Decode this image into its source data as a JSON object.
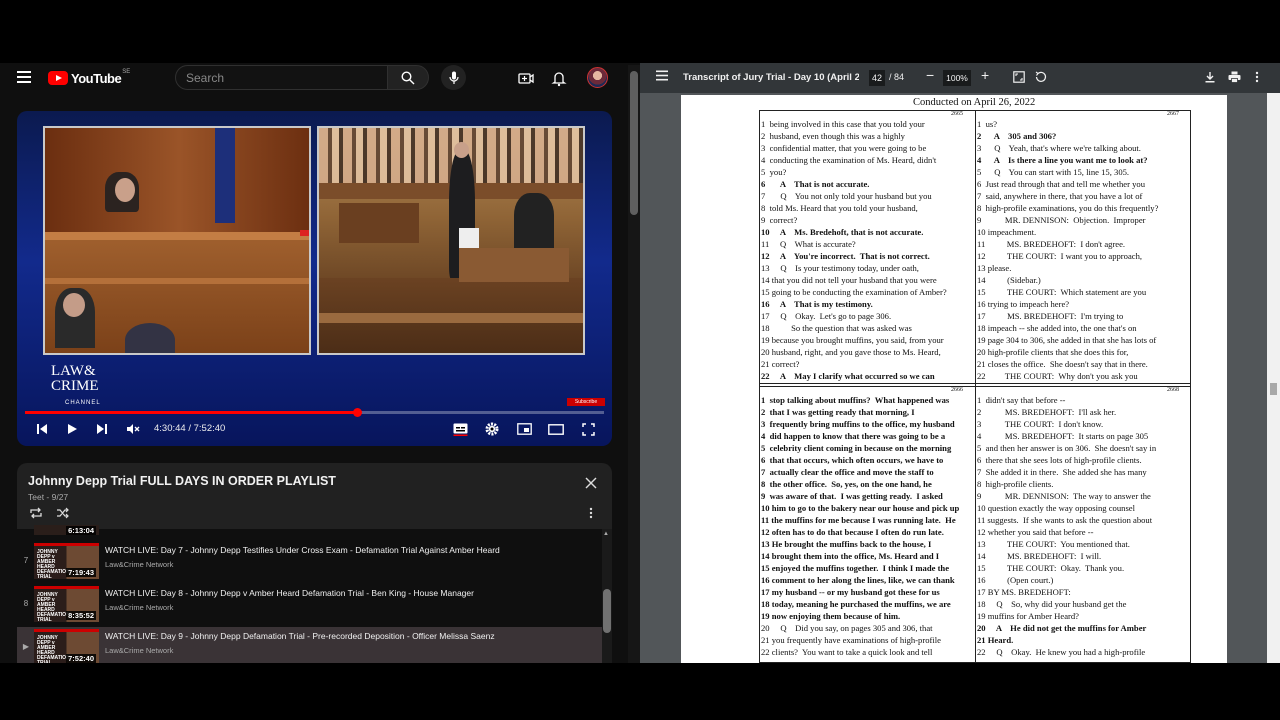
{
  "youtube": {
    "logo_text": "YouTube",
    "country_code": "SE",
    "search_placeholder": "Search",
    "player": {
      "channel_logo_line1": "LAW&",
      "channel_logo_line2": "CRIME",
      "channel_logo_line3": "CHANNEL",
      "subscribe_badge": "Subscribe",
      "time_current": "4:30:44",
      "time_total": "7:52:40",
      "progress_fraction": 0.573
    },
    "playlist": {
      "title": "Johnny Depp Trial FULL DAYS IN ORDER PLAYLIST",
      "subtitle": "Teet - 9/27",
      "top_partial_duration": "6:13:04",
      "items": [
        {
          "index": "7",
          "title": "WATCH LIVE: Day 7 - Johnny Depp Testifies Under Cross Exam - Defamation Trial Against Amber Heard",
          "channel": "Law&Crime Network",
          "duration": "7:19:43",
          "thumb_text": "JOHNNY DEPP v AMBER HEARD DEFAMATION TRIAL"
        },
        {
          "index": "8",
          "title": "WATCH LIVE: Day 8 - Johnny Depp v Amber Heard Defamation Trial - Ben King - House Manager",
          "channel": "Law&Crime Network",
          "duration": "8:35:52",
          "thumb_text": "JOHNNY DEPP v AMBER HEARD DEFAMATION TRIAL"
        },
        {
          "index": "▶",
          "title": "WATCH LIVE: Day 9 - Johnny Depp Defamation Trial - Pre-recorded Deposition - Officer Melissa Saenz",
          "channel": "Law&Crime Network",
          "duration": "7:52:40",
          "thumb_text": "JOHNNY DEPP v AMBER HEARD DEFAMATION TRIAL"
        }
      ]
    }
  },
  "pdf": {
    "title": "Transcript of Jury Trial - Day 10 (April 2...",
    "page_current": "42",
    "page_total": "/ 84",
    "zoom": "100%",
    "header": "Conducted on April 26, 2022",
    "quadrants": [
      {
        "page_no": "2665",
        "lines": [
          {
            "t": "1  being involved in this case that you told your",
            "b": false
          },
          {
            "t": "2  husband, even though this was a highly",
            "b": false
          },
          {
            "t": "3  confidential matter, that you were going to be",
            "b": false
          },
          {
            "t": "4  conducting the examination of Ms. Heard, didn't",
            "b": false
          },
          {
            "t": "5  you?",
            "b": false
          },
          {
            "t": "6       A    That is not accurate.",
            "b": true
          },
          {
            "t": "7       Q    You not only told your husband but you",
            "b": false
          },
          {
            "t": "8  told Ms. Heard that you told your husband,",
            "b": false
          },
          {
            "t": "9  correct?",
            "b": false
          },
          {
            "t": "10     A    Ms. Bredehoft, that is not accurate.",
            "b": true
          },
          {
            "t": "11     Q    What is accurate?",
            "b": false
          },
          {
            "t": "12     A    You're incorrect.  That is not correct.",
            "b": true
          },
          {
            "t": "13     Q    Is your testimony today, under oath,",
            "b": false
          },
          {
            "t": "14 that you did not tell your husband that you were",
            "b": false
          },
          {
            "t": "15 going to be conducting the examination of Amber?",
            "b": false
          },
          {
            "t": "16     A    That is my testimony.",
            "b": true
          },
          {
            "t": "17     Q    Okay.  Let's go to page 306.",
            "b": false
          },
          {
            "t": "18          So the question that was asked was",
            "b": false
          },
          {
            "t": "19 because you brought muffins, you said, from your",
            "b": false
          },
          {
            "t": "20 husband, right, and you gave those to Ms. Heard,",
            "b": false
          },
          {
            "t": "21 correct?",
            "b": false
          },
          {
            "t": "22     A    May I clarify what occurred so we can",
            "b": true
          }
        ]
      },
      {
        "page_no": "2667",
        "lines": [
          {
            "t": "1  us?",
            "b": false
          },
          {
            "t": "2      A    305 and 306?",
            "b": true
          },
          {
            "t": "3      Q    Yeah, that's where we're talking about.",
            "b": false
          },
          {
            "t": "4      A    Is there a line you want me to look at?",
            "b": true
          },
          {
            "t": "5      Q    You can start with 15, line 15, 305.",
            "b": false
          },
          {
            "t": "6  Just read through that and tell me whether you",
            "b": false
          },
          {
            "t": "7  said, anywhere in there, that you have a lot of",
            "b": false
          },
          {
            "t": "8  high-profile examinations, you do this frequently?",
            "b": false
          },
          {
            "t": "9           MR. DENNISON:  Objection.  Improper",
            "b": false
          },
          {
            "t": "10 impeachment.",
            "b": false
          },
          {
            "t": "11          MS. BREDEHOFT:  I don't agree.",
            "b": false
          },
          {
            "t": "12          THE COURT:  I want you to approach,",
            "b": false
          },
          {
            "t": "13 please.",
            "b": false
          },
          {
            "t": "14          (Sidebar.)",
            "b": false
          },
          {
            "t": "15          THE COURT:  Which statement are you",
            "b": false
          },
          {
            "t": "16 trying to impeach here?",
            "b": false
          },
          {
            "t": "17          MS. BREDEHOFT:  I'm trying to",
            "b": false
          },
          {
            "t": "18 impeach -- she added into, the one that's on",
            "b": false
          },
          {
            "t": "19 page 304 to 306, she added in that she has lots of",
            "b": false
          },
          {
            "t": "20 high-profile clients that she does this for,",
            "b": false
          },
          {
            "t": "21 closes the office.  She doesn't say that in there.",
            "b": false
          },
          {
            "t": "22         THE COURT:  Why don't you ask you",
            "b": false
          }
        ]
      },
      {
        "page_no": "2666",
        "lines": [
          {
            "t": "1  stop talking about muffins?  What happened was",
            "b": true
          },
          {
            "t": "2  that I was getting ready that morning, I",
            "b": true
          },
          {
            "t": "3  frequently bring muffins to the office, my husband",
            "b": true
          },
          {
            "t": "4  did happen to know that there was going to be a",
            "b": true
          },
          {
            "t": "5  celebrity client coming in because on the morning",
            "b": true
          },
          {
            "t": "6  that that occurs, which often occurs, we have to",
            "b": true
          },
          {
            "t": "7  actually clear the office and move the staff to",
            "b": true
          },
          {
            "t": "8  the other office.  So, yes, on the one hand, he",
            "b": true
          },
          {
            "t": "9  was aware of that.  I was getting ready.  I asked",
            "b": true
          },
          {
            "t": "10 him to go to the bakery near our house and pick up",
            "b": true
          },
          {
            "t": "11 the muffins for me because I was running late.  He",
            "b": true
          },
          {
            "t": "12 often has to do that because I often do run late.",
            "b": true
          },
          {
            "t": "13 He brought the muffins back to the house, I",
            "b": true
          },
          {
            "t": "14 brought them into the office, Ms. Heard and I",
            "b": true
          },
          {
            "t": "15 enjoyed the muffins together.  I think I made the",
            "b": true
          },
          {
            "t": "16 comment to her along the lines, like, we can thank",
            "b": true
          },
          {
            "t": "17 my husband -- or my husband got these for us",
            "b": true
          },
          {
            "t": "18 today, meaning he purchased the muffins, we are",
            "b": true
          },
          {
            "t": "19 now enjoying them because of him.",
            "b": true
          },
          {
            "t": "20     Q    Did you say, on pages 305 and 306, that",
            "b": false
          },
          {
            "t": "21 you frequently have examinations of high-profile",
            "b": false
          },
          {
            "t": "22 clients?  You want to take a quick look and tell",
            "b": false
          }
        ]
      },
      {
        "page_no": "2668",
        "lines": [
          {
            "t": "1  didn't say that before --",
            "b": false
          },
          {
            "t": "2           MS. BREDEHOFT:  I'll ask her.",
            "b": false
          },
          {
            "t": "3           THE COURT:  I don't know.",
            "b": false
          },
          {
            "t": "4           MS. BREDEHOFT:  It starts on page 305",
            "b": false
          },
          {
            "t": "5  and then her answer is on 306.  She doesn't say in",
            "b": false
          },
          {
            "t": "6  there that she sees lots of high-profile clients.",
            "b": false
          },
          {
            "t": "7  She added it in there.  She added she has many",
            "b": false
          },
          {
            "t": "8  high-profile clients.",
            "b": false
          },
          {
            "t": "9           MR. DENNISON:  The way to answer the",
            "b": false
          },
          {
            "t": "10 question exactly the way opposing counsel",
            "b": false
          },
          {
            "t": "11 suggests.  If she wants to ask the question about",
            "b": false
          },
          {
            "t": "12 whether you said that before --",
            "b": false
          },
          {
            "t": "13          THE COURT:  You mentioned that.",
            "b": false
          },
          {
            "t": "14          MS. BREDEHOFT:  I will.",
            "b": false
          },
          {
            "t": "15          THE COURT:  Okay.  Thank you.",
            "b": false
          },
          {
            "t": "16          (Open court.)",
            "b": false
          },
          {
            "t": "17 BY MS. BREDEHOFT:",
            "b": false
          },
          {
            "t": "18     Q    So, why did your husband get the",
            "b": false
          },
          {
            "t": "19 muffins for Amber Heard?",
            "b": false
          },
          {
            "t": "20     A    He did not get the muffins for Amber",
            "b": true
          },
          {
            "t": "21 Heard.",
            "b": true
          },
          {
            "t": "22     Q    Okay.  He knew you had a high-profile",
            "b": false
          }
        ]
      }
    ]
  },
  "colors": {
    "youtube_bg": "#0f0f0f",
    "youtube_red": "#ff0000",
    "pdf_toolbar": "#323639",
    "pdf_bg": "#525659"
  }
}
